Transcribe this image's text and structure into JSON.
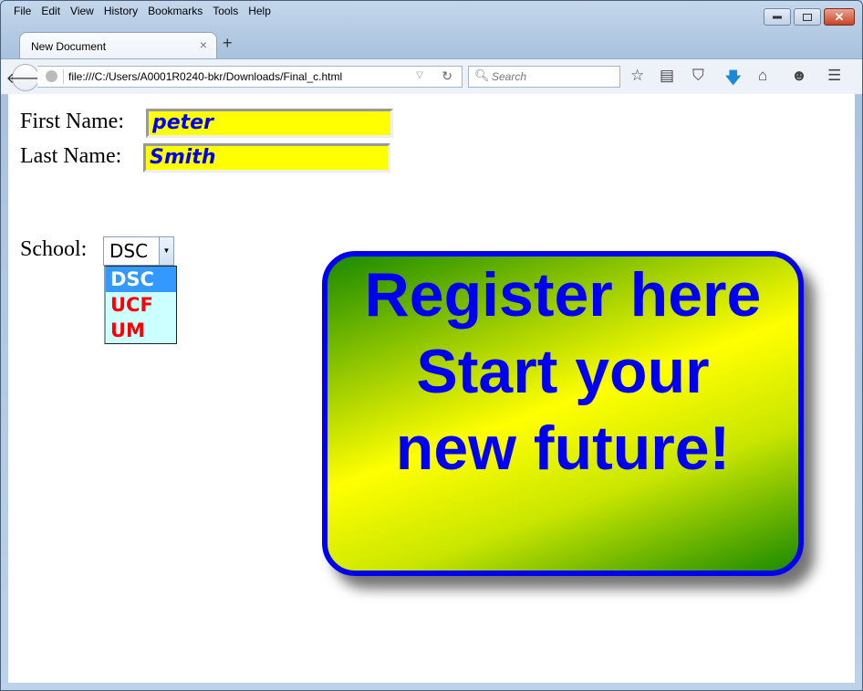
{
  "browser": {
    "menu": [
      "File",
      "Edit",
      "View",
      "History",
      "Bookmarks",
      "Tools",
      "Help"
    ],
    "tab_title": "New Document",
    "tab_close": "×",
    "new_tab": "+",
    "url": "file:///C:/Users/A0001R0240-bkr/Downloads/Final_c.html",
    "search_placeholder": "Search",
    "icons": [
      "star-icon",
      "reading-list-icon",
      "pocket-icon",
      "download-icon",
      "home-icon",
      "chat-icon",
      "menu-icon"
    ]
  },
  "form": {
    "first_name_label": "First Name:",
    "first_name_value": "peter",
    "last_name_label": "Last Name:",
    "last_name_value": "Smith",
    "school_label": "School:",
    "school_selected": "DSC",
    "school_options": [
      "DSC",
      "UCF",
      "UM"
    ]
  },
  "promo": {
    "lines": [
      "Register here",
      "Start your",
      "new future!"
    ]
  },
  "colors": {
    "input_bg": "#ffff00",
    "input_text": "#0000ee",
    "option_text": "#ff0000",
    "promo_border": "#0000ee"
  }
}
